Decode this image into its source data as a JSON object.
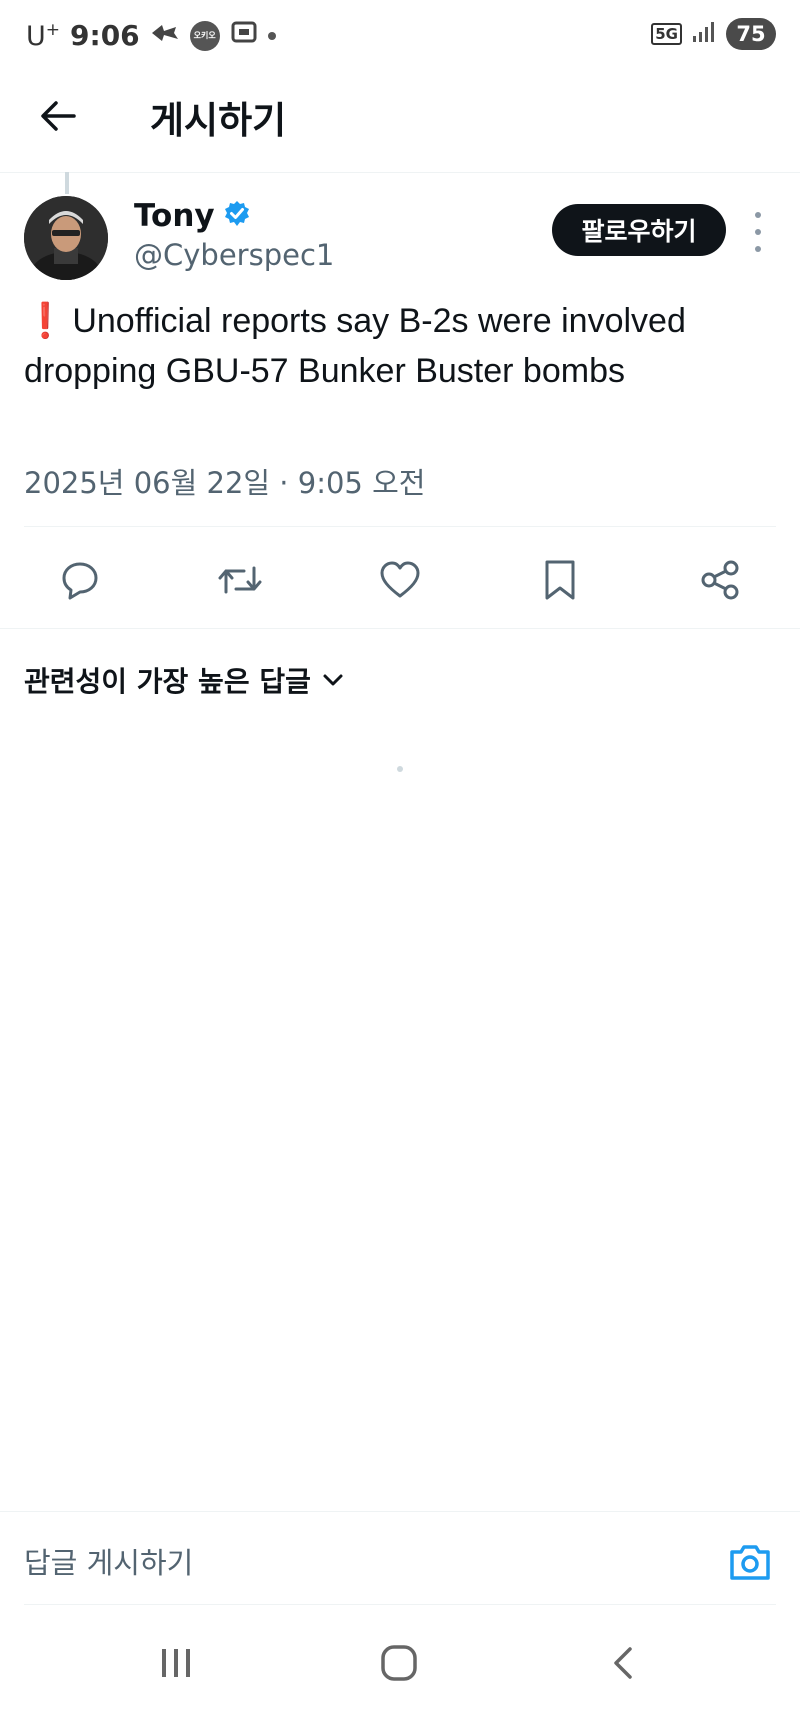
{
  "status_bar": {
    "carrier": "U",
    "carrier_sup": "+",
    "time": "9:06",
    "bubble_text": "오키오",
    "network": "5G",
    "battery": "75"
  },
  "header": {
    "title": "게시하기"
  },
  "post": {
    "author_name": "Tony",
    "author_handle": "@Cyberspec1",
    "follow_label": "팔로우하기",
    "exclaim": "❗",
    "text": "Unofficial reports say B-2s were involved dropping GBU-57 Bunker Buster bombs",
    "timestamp": "2025년 06월 22일 · 9:05 오전"
  },
  "actions": [
    "reply-icon",
    "retweet-icon",
    "like-icon",
    "bookmark-icon",
    "share-icon"
  ],
  "replies": {
    "sort_label": "관련성이 가장 높은 답글"
  },
  "reply_bar": {
    "placeholder": "답글 게시하기"
  },
  "colors": {
    "text": "#0f1419",
    "secondary": "#536471",
    "verified": "#1d9bf0",
    "camera": "#1d9bf0",
    "exclaim": "#e0245e"
  }
}
